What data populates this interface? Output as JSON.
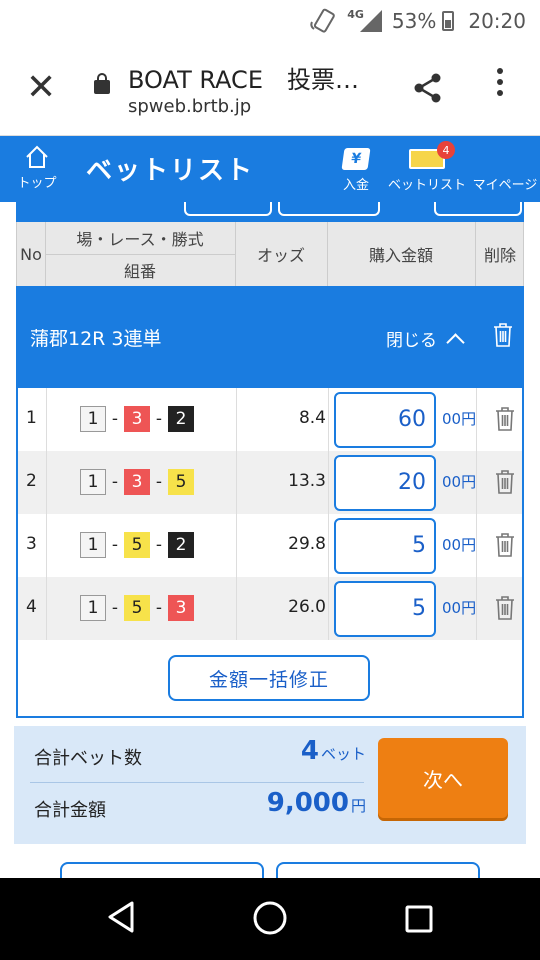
{
  "status_bar": {
    "network": "4G",
    "battery": "53%",
    "time": "20:20"
  },
  "browser": {
    "title": "BOAT RACE　投票…",
    "url": "spweb.brtb.jp"
  },
  "header": {
    "home_label": "トップ",
    "page_title": "ベットリスト",
    "nav": [
      {
        "label": "入金",
        "icon": "yen-icon"
      },
      {
        "label": "ベットリスト",
        "icon": "ticket-icon",
        "badge": "4"
      },
      {
        "label": "マイページ",
        "icon": "hamburger-icon"
      }
    ]
  },
  "table_header": {
    "no": "No",
    "race": "場・レース・勝式",
    "combo": "組番",
    "odds": "オッズ",
    "amount": "購入金額",
    "delete": "削除"
  },
  "group": {
    "title": "蒲郡12R 3連単",
    "toggle_label": "閉じる"
  },
  "bets": [
    {
      "no": "1",
      "boats": [
        "1",
        "3",
        "2"
      ],
      "odds": "8.4",
      "amount": "60",
      "unit": "00円"
    },
    {
      "no": "2",
      "boats": [
        "1",
        "3",
        "5"
      ],
      "odds": "13.3",
      "amount": "20",
      "unit": "00円"
    },
    {
      "no": "3",
      "boats": [
        "1",
        "5",
        "2"
      ],
      "odds": "29.8",
      "amount": "5",
      "unit": "00円"
    },
    {
      "no": "4",
      "boats": [
        "1",
        "5",
        "3"
      ],
      "odds": "26.0",
      "amount": "5",
      "unit": "00円"
    }
  ],
  "bulk_button": "金額一括修正",
  "summary": {
    "count_label": "合計ベット数",
    "count_value": "4",
    "count_unit": "ベット",
    "total_label": "合計金額",
    "total_value": "9,000",
    "total_unit": "円",
    "next_button": "次へ"
  },
  "colors": {
    "primary": "#1a7ce0",
    "accent": "#ee7f12",
    "boat_1": "#f4f4f4",
    "boat_2": "#222222",
    "boat_3": "#ee5555",
    "boat_5": "#f7e24a"
  }
}
